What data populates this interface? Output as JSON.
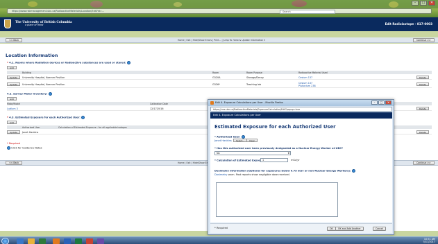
{
  "browser": {
    "url": "https://www.riskmanagement.ubc.ca/RadioactiveMaterials/Location/Edit?id=...",
    "search_placeholder": "Search",
    "win_min": "–",
    "win_max": "□",
    "win_close": "✕"
  },
  "header": {
    "university_name": "The University of British Columbia",
    "university_sub": "a place of mind",
    "page_context": "Edit Radioisotope - 817-0003"
  },
  "nav": {
    "back_label": "<< Back",
    "continue_label": "Continue >>",
    "links": "Home | Exit | Hide/Show Errors | Print... | Jump To: View & Update Information ▾"
  },
  "main": {
    "title": "Location Information",
    "q41": "4.1. Rooms where Radiation devices or Radioactive substances are used or stored:",
    "add_label": "Add",
    "rooms_columns": [
      "Building",
      "Room",
      "Room Purpose",
      "Radioactive Material Used"
    ],
    "rooms": [
      {
        "update": "Update",
        "building": "University Hospital, Koerner Pavilion",
        "room": "G320A",
        "purpose": "Storage/Decay",
        "material": "Cesium 137",
        "material2": "",
        "delete": "Delete"
      },
      {
        "update": "Update",
        "building": "University Hospital, Koerner Pavilion",
        "room": "G326*",
        "purpose": "Teaching lab",
        "material": "Cesium 137",
        "material2": "Plutonium 238",
        "delete": "Delete"
      }
    ],
    "q42": "4.2. Survey Meter Inventory:",
    "meter_columns": [
      "Make/Model",
      "Calibration Date"
    ],
    "meters": [
      {
        "model": "Ludlum 3",
        "date": "12/17/2016",
        "delete": "Delete"
      }
    ],
    "q43": "4.3. Estimated Exposure for each Authorized User:",
    "exposure_columns": [
      "Authorized User",
      "Calculation of Estimated Exposure - for all applicable isotopes"
    ],
    "exposures": [
      {
        "update": "Update",
        "user": "Janet Hankins",
        "delete": "Delete"
      }
    ],
    "required_note": "* Required",
    "guidance_note": "Click for Guidance Notes"
  },
  "dialog": {
    "window_title": "Edit 4. Exposure Calculations per User - Mozilla Firefox",
    "url": "https://rms.ubc.ca/RadioactiveMaterials/ExposureCalculation/Edit?popup=true",
    "header": "Edit 4. Exposure Calculations per User",
    "heading": "Estimated Exposure for each Authorized User",
    "authorized_user_label": "* Authorized User:",
    "authorized_user_value": "Janet Hankins",
    "select_btn": "Select...",
    "clear_btn": "Clear",
    "nuclear_worker_label": "* Has this authorized user been previously designated as a Nuclear Energy Worker at UBC?",
    "nuclear_worker_value": "No",
    "calc_label": "* Calculation of Estimated Exposure:",
    "calc_value": "1",
    "calc_unit": "mSv/yr",
    "dosimetry_label": "Dosimetry Information (Optional for exposures below 0.75 mSv or non-Nuclear Energy Workers):",
    "dosimetry_link": "Dosimetry",
    "dosimetry_text": "worn. Past reports show negligible dose received.",
    "required": "* Required",
    "ok_btn": "OK",
    "ok_add_btn": "OK and Add Another",
    "cancel_btn": "Cancel"
  },
  "taskbar": {
    "time": "10:51 AM",
    "date": "5/11/2017"
  }
}
